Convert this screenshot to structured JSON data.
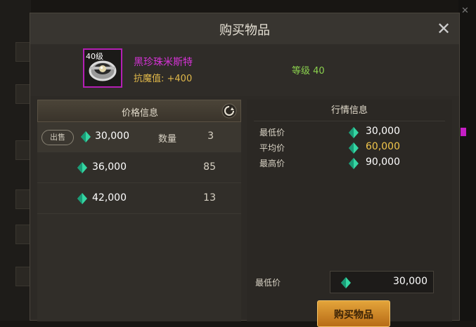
{
  "dialog": {
    "title": "购买物品",
    "close_icon": "close-icon"
  },
  "item": {
    "level_badge": "40级",
    "name": "黑珍珠米斯特",
    "stat": "抗魔值: +400",
    "grade": "等级 40",
    "name_color": "#d633d6",
    "icon": "ring-icon"
  },
  "price_panel": {
    "header": "价格信息",
    "sell_label": "出售",
    "qty_label": "数量",
    "rows": [
      {
        "price": "30,000",
        "qty": "3",
        "selected": true
      },
      {
        "price": "36,000",
        "qty": "85"
      },
      {
        "price": "42,000",
        "qty": "13"
      }
    ]
  },
  "market_panel": {
    "header": "行情信息",
    "rows": [
      {
        "label": "最低价",
        "value": "30,000"
      },
      {
        "label": "平均价",
        "value": "60,000",
        "highlight": "#f2c64b"
      },
      {
        "label": "最高价",
        "value": "90,000"
      }
    ],
    "min_price_label": "最低价",
    "min_price_value": "30,000",
    "buy_button": "购买物品"
  },
  "colors": {
    "accent": "#e3a43a",
    "currency": "#35d6a3"
  }
}
